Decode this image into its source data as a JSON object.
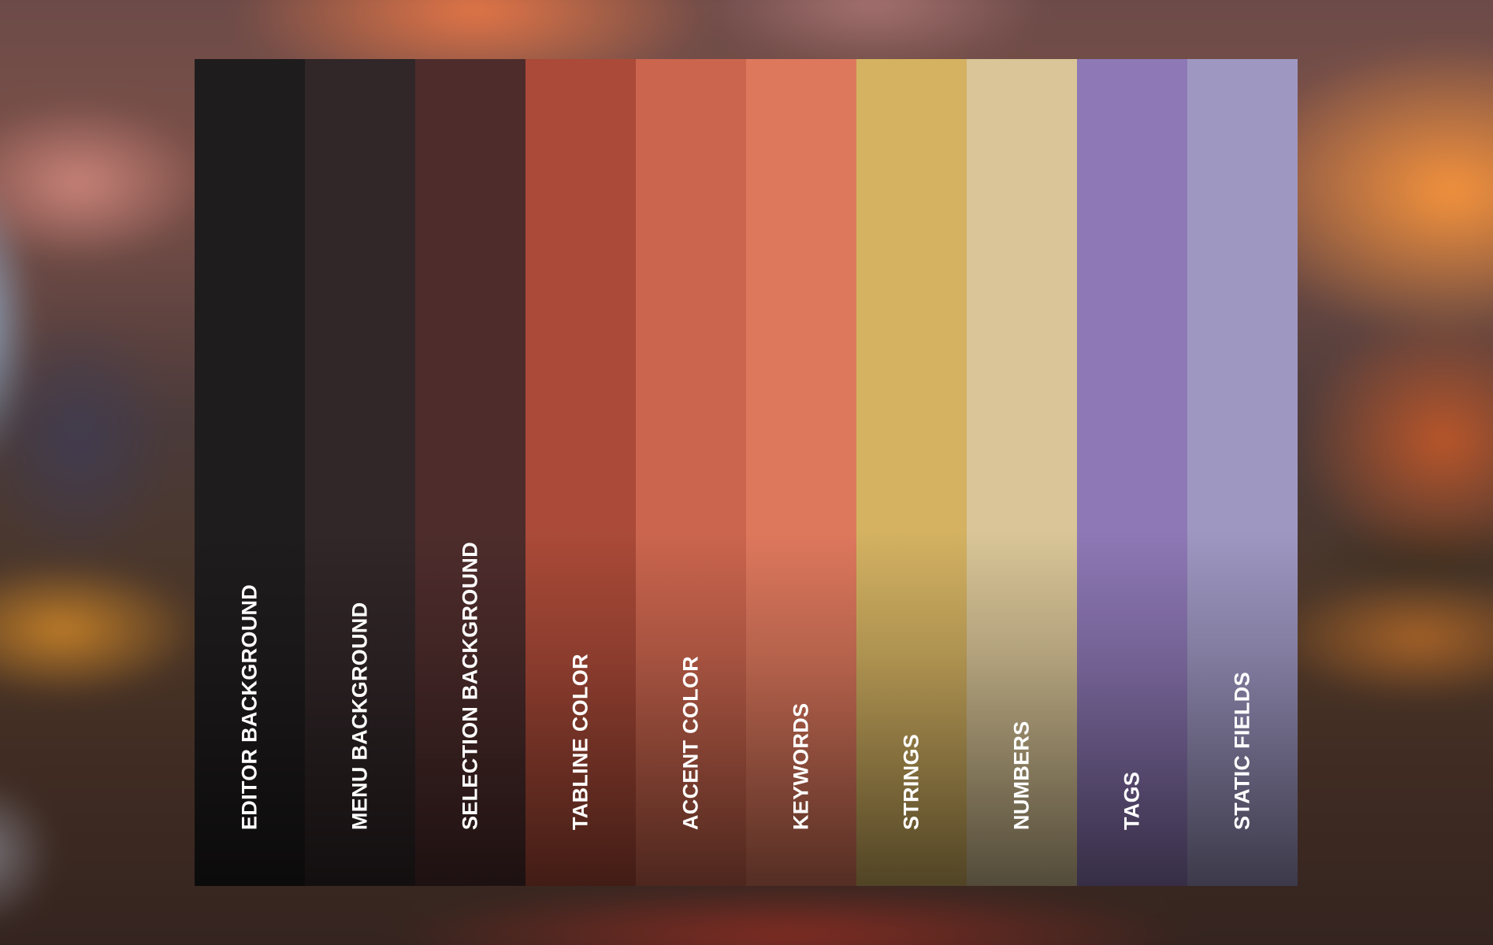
{
  "palette": {
    "swatches": [
      {
        "label": "EDITOR BACKGROUND",
        "color": "#1f1c1d"
      },
      {
        "label": "MENU BACKGROUND",
        "color": "#312628"
      },
      {
        "label": "SELECTION BACKGROUND",
        "color": "#4e2c2c"
      },
      {
        "label": "TABLINE COLOR",
        "color": "#ab4a38"
      },
      {
        "label": "ACCENT COLOR",
        "color": "#cb654e"
      },
      {
        "label": "KEYWORDS",
        "color": "#de785d"
      },
      {
        "label": "STRINGS",
        "color": "#d4b262"
      },
      {
        "label": "NUMBERS",
        "color": "#d9c597"
      },
      {
        "label": "TAGS",
        "color": "#8e78b6"
      },
      {
        "label": "STATIC FIELDS",
        "color": "#9e97c2"
      }
    ]
  }
}
